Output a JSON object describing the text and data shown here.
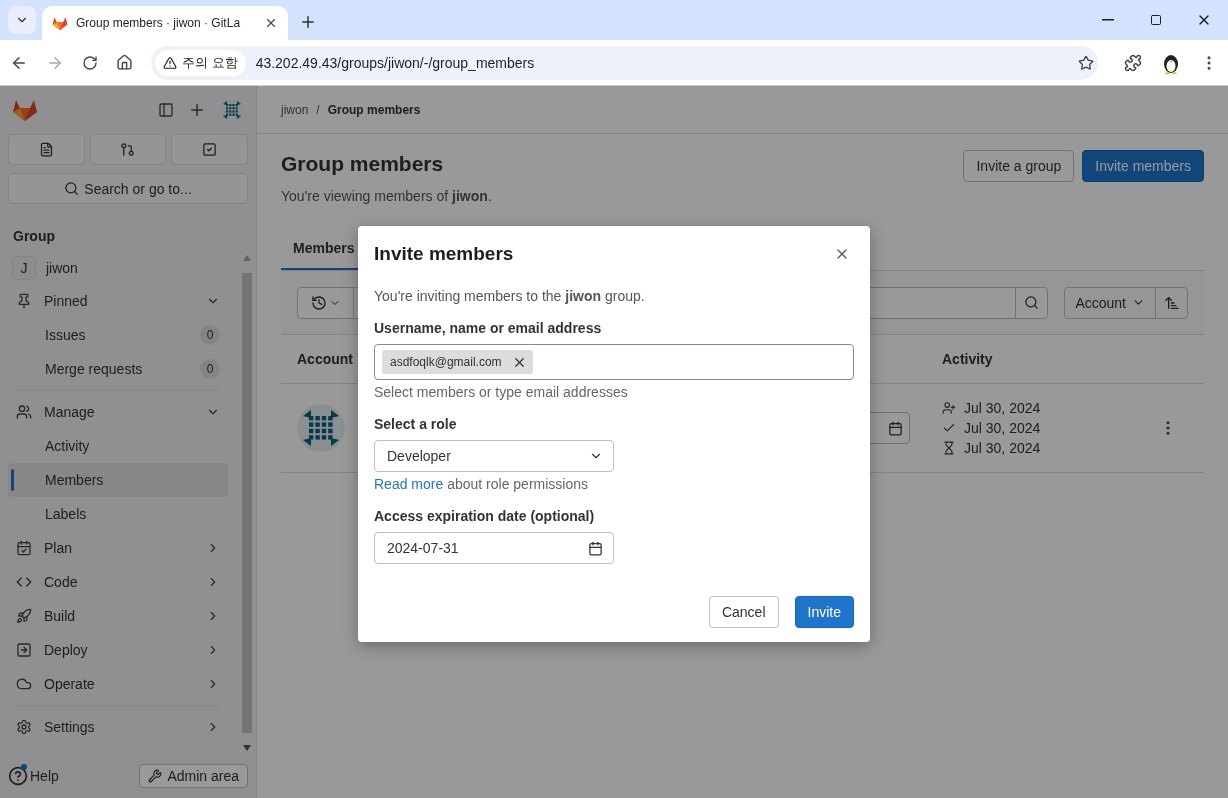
{
  "browser": {
    "tab_title": "Group members · jiwon · GitLa",
    "warning": "주의 요함",
    "url": "43.202.49.43/groups/jiwon/-/group_members"
  },
  "sidebar": {
    "search_placeholder": "Search or go to...",
    "heading": "Group",
    "group": {
      "letter": "J",
      "name": "jiwon"
    },
    "sections": [
      {
        "label": "Pinned",
        "expanded": true,
        "children": [
          {
            "label": "Issues",
            "count": "0",
            "selected": false
          },
          {
            "label": "Merge requests",
            "count": "0",
            "selected": false
          }
        ]
      },
      {
        "label": "Manage",
        "expanded": true,
        "children": [
          {
            "label": "Activity",
            "selected": false
          },
          {
            "label": "Members",
            "selected": true
          },
          {
            "label": "Labels",
            "selected": false
          }
        ]
      },
      {
        "label": "Plan",
        "expanded": false
      },
      {
        "label": "Code",
        "expanded": false
      },
      {
        "label": "Build",
        "expanded": false
      },
      {
        "label": "Deploy",
        "expanded": false
      },
      {
        "label": "Operate",
        "expanded": false
      },
      {
        "label": "Settings",
        "expanded": false
      }
    ],
    "help": "Help",
    "admin": "Admin area"
  },
  "main": {
    "breadcrumbs": [
      "jiwon",
      "Group members"
    ],
    "breadcrumb_separator": "/",
    "title": "Group members",
    "subtitle": "You're viewing members of **jiwon**.",
    "invite_group": "Invite a group",
    "invite_members": "Invite members",
    "tabs": [
      {
        "label": "Members",
        "selected": true
      }
    ],
    "sort": "Account",
    "columns": [
      "Account",
      "Activity"
    ],
    "rows": [
      {
        "activity": [
          "Jul 30, 2024",
          "Jul 30, 2024",
          "Jul 30, 2024"
        ]
      }
    ]
  },
  "modal": {
    "title": "Invite members",
    "intro": "You're inviting members to the **jiwon** group.",
    "username_label": "Username, name or email address",
    "tokens": [
      "asdfoqlk@gmail.com"
    ],
    "username_help": "Select members or type email addresses",
    "role_label": "Select a role",
    "role": "Developer",
    "role_link": "Read more",
    "role_help": "about role permissions",
    "date_label": "Access expiration date (optional)",
    "date": "2024-07-31",
    "cancel": "Cancel",
    "invite": "Invite"
  }
}
